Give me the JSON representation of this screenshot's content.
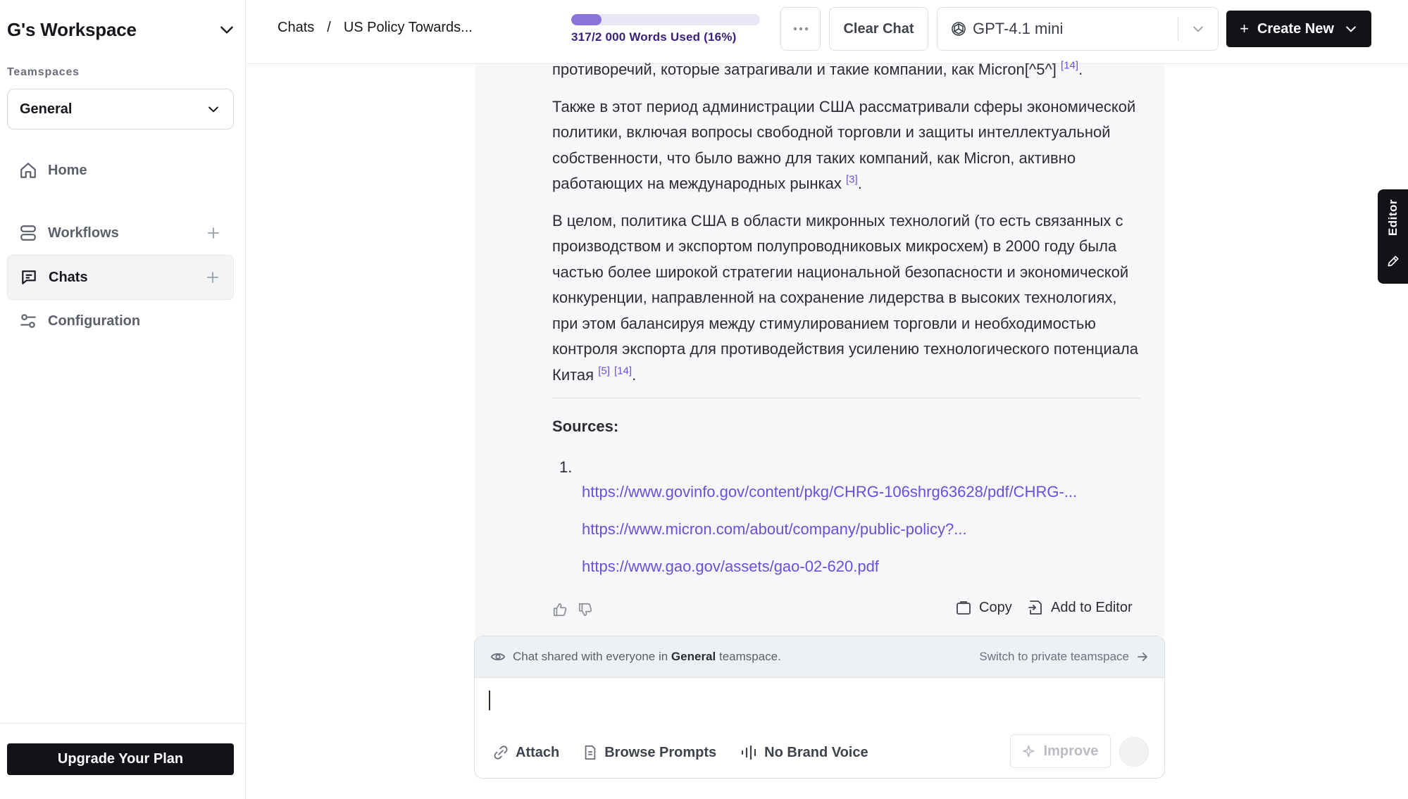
{
  "sidebar": {
    "workspace_title": "G's Workspace",
    "teamspaces_label": "Teamspaces",
    "teamspace_selected": "General",
    "nav": [
      {
        "label": "Home",
        "icon": "home-icon"
      },
      {
        "label": "Workflows",
        "icon": "workflows-icon"
      },
      {
        "label": "Chats",
        "icon": "chats-icon"
      },
      {
        "label": "Configuration",
        "icon": "configuration-icon"
      }
    ],
    "upgrade_label": "Upgrade Your Plan"
  },
  "topbar": {
    "breadcrumb": [
      "Chats",
      "US Policy Towards..."
    ],
    "breadcrumb_sep": "/",
    "usage_text": "317/2 000 Words Used (16%)",
    "usage_fraction": 0.16,
    "clear_label": "Clear Chat",
    "model_label": "GPT-4.1 mini",
    "create_label": "Create New"
  },
  "message": {
    "p0_text": "противоречий, которые затрагивали и такие компании, как Micron[^5^]",
    "p0_cite": "[14]",
    "p1_text": "Также в этот период администрации США рассматривали сферы экономической политики, включая вопросы свободной торговли и защиты интеллектуальной собственности, что было важно для таких компаний, как Micron, активно работающих на международных рынках",
    "p1_cite": "[3]",
    "p2_text": "В целом, политика США в области микронных технологий (то есть связанных с производством и экспортом полупроводниковых микросхем) в 2000 году была частью более широкой стратегии национальной безопасности и экономической конкуренции, направленной на сохранение лидерства в высоких технологиях, при этом балансируя между стимулированием торговли и необходимостью контроля экспорта для противодействия усилению технологического потенциала Китая",
    "p2_cite1": "[5]",
    "p2_cite2": "[14]",
    "sources_title": "Sources:",
    "source_number": "1.",
    "sources": [
      "https://www.govinfo.gov/content/pkg/CHRG-106shrg63628/pdf/CHRG-...",
      "https://www.micron.com/about/company/public-policy?...",
      "https://www.gao.gov/assets/gao-02-620.pdf"
    ],
    "copy_label": "Copy",
    "add_to_editor_label": "Add to Editor"
  },
  "composer": {
    "share_prefix": "Chat shared with everyone in",
    "share_team": "General",
    "share_suffix": "teamspace.",
    "switch_label": "Switch to private teamspace",
    "attach_label": "Attach",
    "browse_label": "Browse Prompts",
    "brand_voice_label": "No Brand Voice",
    "improve_label": "Improve"
  },
  "editor_tab_label": "Editor",
  "colors": {
    "accent": "#6b4fd8",
    "usage_fill": "#8a74d8",
    "dark_button": "#111318",
    "panel_bg": "#f7f7f9"
  }
}
